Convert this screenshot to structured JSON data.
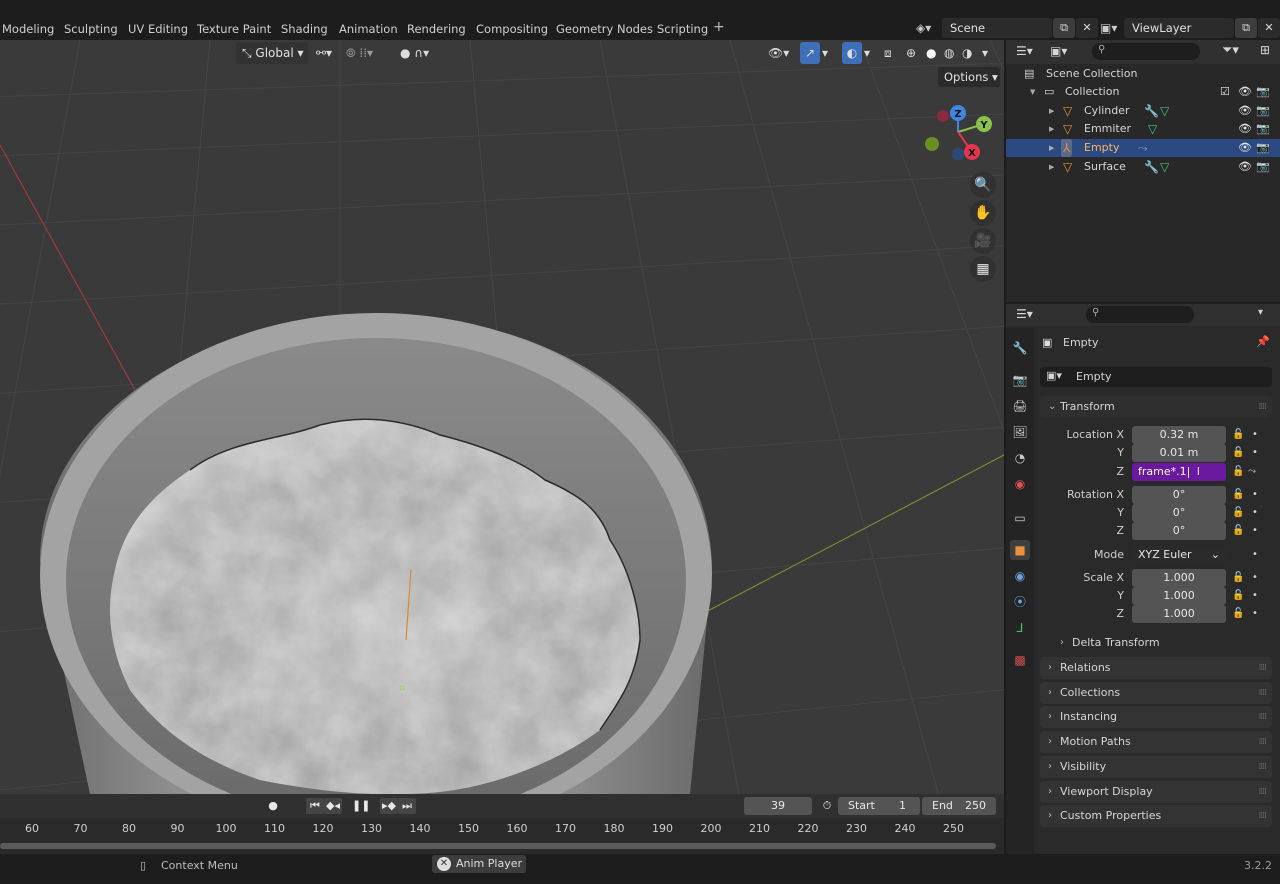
{
  "workspaces": [
    "Modeling",
    "Sculpting",
    "UV Editing",
    "Texture Paint",
    "Shading",
    "Animation",
    "Rendering",
    "Compositing",
    "Geometry Nodes",
    "Scripting"
  ],
  "add_workspace": "+",
  "scene": {
    "label": "Scene"
  },
  "view_layer": {
    "label": "ViewLayer"
  },
  "viewport": {
    "orientation": "Global",
    "options_label": "Options",
    "gizmo_axes": {
      "x": "X",
      "y": "Y",
      "z": "Z"
    }
  },
  "outliner": {
    "root": "Scene Collection",
    "collection": "Collection",
    "items": [
      {
        "name": "Cylinder",
        "selected": false
      },
      {
        "name": "Emmiter",
        "selected": false
      },
      {
        "name": "Empty",
        "selected": true
      },
      {
        "name": "Surface",
        "selected": false
      }
    ]
  },
  "properties": {
    "object_name": "Empty",
    "data_name": "Empty",
    "transform": {
      "title": "Transform",
      "location_x_label": "Location X",
      "location_y_label": "Y",
      "location_z_label": "Z",
      "location_x": "0.32 m",
      "location_y": "0.01 m",
      "location_z_editing": "frame*.1",
      "rotation_x_label": "Rotation X",
      "rotation_y_label": "Y",
      "rotation_z_label": "Z",
      "rotation_x": "0°",
      "rotation_y": "0°",
      "rotation_z": "0°",
      "mode_label": "Mode",
      "mode": "XYZ Euler",
      "scale_x_label": "Scale X",
      "scale_y_label": "Y",
      "scale_z_label": "Z",
      "scale_x": "1.000",
      "scale_y": "1.000",
      "scale_z": "1.000",
      "delta_transform": "Delta Transform"
    },
    "panels": [
      "Relations",
      "Collections",
      "Instancing",
      "Motion Paths",
      "Visibility",
      "Viewport Display",
      "Custom Properties"
    ]
  },
  "timeline": {
    "current_frame": "39",
    "start_label": "Start",
    "start": "1",
    "end_label": "End",
    "end": "250",
    "ticks": [
      "60",
      "70",
      "80",
      "90",
      "100",
      "110",
      "120",
      "130",
      "140",
      "150",
      "160",
      "170",
      "180",
      "190",
      "200",
      "210",
      "220",
      "230",
      "240",
      "250"
    ]
  },
  "statusbar": {
    "context_menu": "Context Menu",
    "anim_player": "Anim Player",
    "version": "3.2.2"
  },
  "colors": {
    "selection": "#2c4a82",
    "field_editing": "#6a1a9e",
    "object_orange": "#e8913a",
    "axis_x": "#e5344f",
    "axis_y": "#8bc34a",
    "axis_z": "#3f86e0"
  }
}
